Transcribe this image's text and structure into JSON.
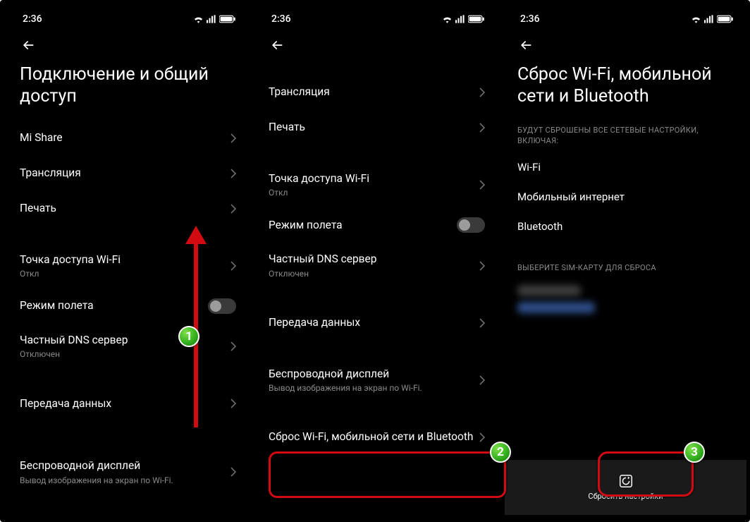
{
  "status": {
    "time": "2:36"
  },
  "steps": {
    "s1": "1",
    "s2": "2",
    "s3": "3"
  },
  "screen1": {
    "title": "Подключение и общий доступ",
    "items": {
      "mishare": {
        "label": "Mi Share"
      },
      "cast": {
        "label": "Трансляция"
      },
      "print": {
        "label": "Печать"
      },
      "hotspot": {
        "label": "Точка доступа Wi-Fi",
        "sub": "Откл"
      },
      "airplane": {
        "label": "Режим полета"
      },
      "dns": {
        "label": "Частный DNS сервер",
        "sub": "Отключен"
      },
      "datashare": {
        "label": "Передача данных"
      },
      "wdisplay": {
        "label": "Беспроводной дисплей",
        "sub": "Вывод изображения на экран по Wi-Fi."
      }
    }
  },
  "screen2": {
    "items": {
      "cast": {
        "label": "Трансляция"
      },
      "print": {
        "label": "Печать"
      },
      "hotspot": {
        "label": "Точка доступа Wi-Fi",
        "sub": "Откл"
      },
      "airplane": {
        "label": "Режим полета"
      },
      "dns": {
        "label": "Частный DNS сервер",
        "sub": "Отключен"
      },
      "datashare": {
        "label": "Передача данных"
      },
      "wdisplay": {
        "label": "Беспроводной дисплей",
        "sub": "Вывод изображения на экран по Wi-Fi."
      },
      "reset": {
        "label": "Сброс Wi-Fi, мобильной сети и Bluetooth"
      }
    }
  },
  "screen3": {
    "title": "Сброс Wi-Fi, мобильной сети и Bluetooth",
    "desc": "БУДУТ СБРОШЕНЫ ВСЕ СЕТЕВЫЕ НАСТРОЙКИ, ВКЛЮЧАЯ:",
    "lines": {
      "wifi": "Wi-Fi",
      "mobile": "Мобильный интернет",
      "bt": "Bluetooth"
    },
    "sim_header": "ВЫБЕРИТЕ SIM-КАРТУ ДЛЯ СБРОСА",
    "reset_btn": "Сбросить настройки"
  }
}
